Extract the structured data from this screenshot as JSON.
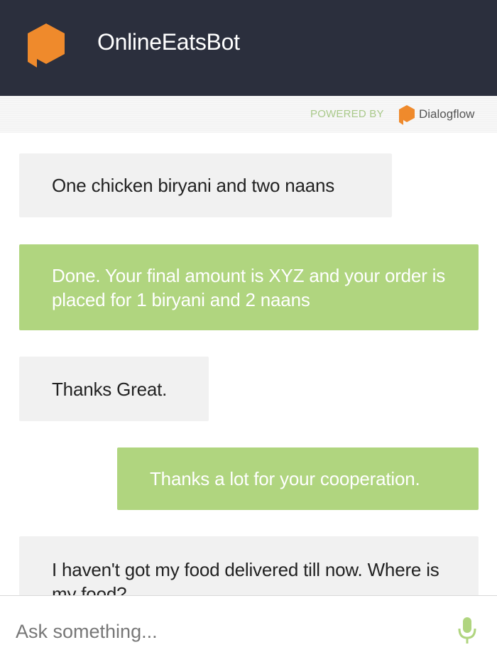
{
  "header": {
    "title": "OnlineEatsBot",
    "logo_icon": "bot-speech-bubble-icon",
    "background_color": "#2b2f3d",
    "logo_color": "#ef8a2c"
  },
  "powered": {
    "label": "POWERED BY",
    "brand": "Dialogflow",
    "brand_icon": "dialogflow-logo-icon"
  },
  "messages": [
    {
      "sender": "user",
      "text": "One chicken biryani and two naans"
    },
    {
      "sender": "bot",
      "text": "Done. Your final amount is XYZ and your order is placed for 1 biryani and 2 naans"
    },
    {
      "sender": "user",
      "text": "Thanks Great."
    },
    {
      "sender": "bot",
      "text": "Thanks a lot for your cooperation."
    },
    {
      "sender": "user",
      "text": "I haven't got my food delivered till now. Where is my food?"
    }
  ],
  "colors": {
    "user_bubble": "#f1f1f1",
    "bot_bubble": "#b0d57f",
    "powered_text": "#a9c98a"
  },
  "input": {
    "placeholder": "Ask something...",
    "value": "",
    "mic_icon": "microphone-icon"
  }
}
